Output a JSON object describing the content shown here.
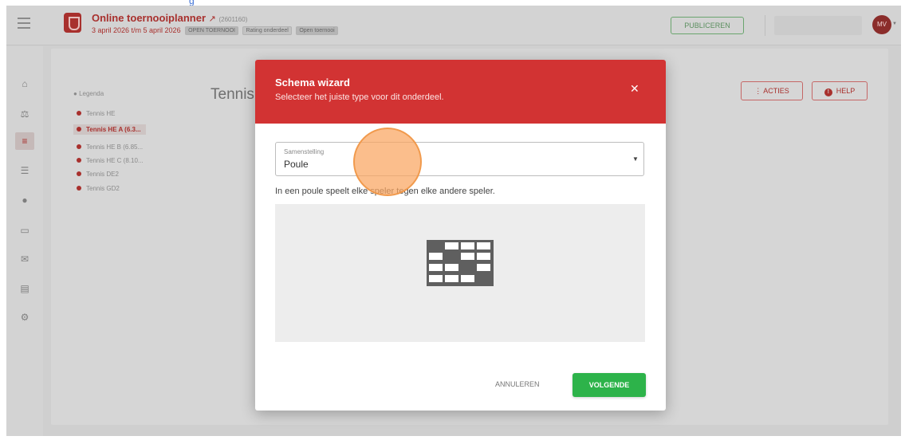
{
  "top_fragment": "g",
  "header": {
    "title": "Online toernooiplanner",
    "id": "(2601160)",
    "date_range": "3 april 2026 t/m 5 april 2026",
    "badges": [
      "OPEN TOERNOOI",
      "Rating onderdeel",
      "Open toernooi"
    ],
    "publish_label": "PUBLICEREN",
    "avatar_initials": "MV",
    "accent_color": "#a8302d"
  },
  "rail": {
    "icons": [
      "home-icon",
      "scale-icon",
      "list-icon",
      "bracket-icon",
      "ball-icon",
      "monitor-icon",
      "mail-icon",
      "print-icon",
      "settings-icon"
    ],
    "active_icon": "list-icon"
  },
  "sidebar": {
    "legend_title": "Legenda",
    "items": [
      {
        "label": "Tennis HE"
      },
      {
        "label": "Tennis HE A (6.3..."
      },
      {
        "label": "Tennis HE B (6.85..."
      },
      {
        "label": "Tennis HE C (8.10..."
      },
      {
        "label": "Tennis DE2"
      },
      {
        "label": "Tennis GD2"
      }
    ],
    "active_index": 1
  },
  "main": {
    "heading": "Tennis",
    "acties_label": "ACTIES",
    "help_label": "HELP"
  },
  "modal": {
    "title": "Schema wizard",
    "subtitle": "Selecteer het juiste type voor dit onderdeel.",
    "header_color": "#d23333",
    "select_label": "Samenstelling",
    "select_value": "Poule",
    "description": "In een poule speelt elke speler tegen elke andere speler.",
    "cancel_label": "ANNULEREN",
    "next_label": "VOLGENDE",
    "next_color": "#2db34a"
  }
}
